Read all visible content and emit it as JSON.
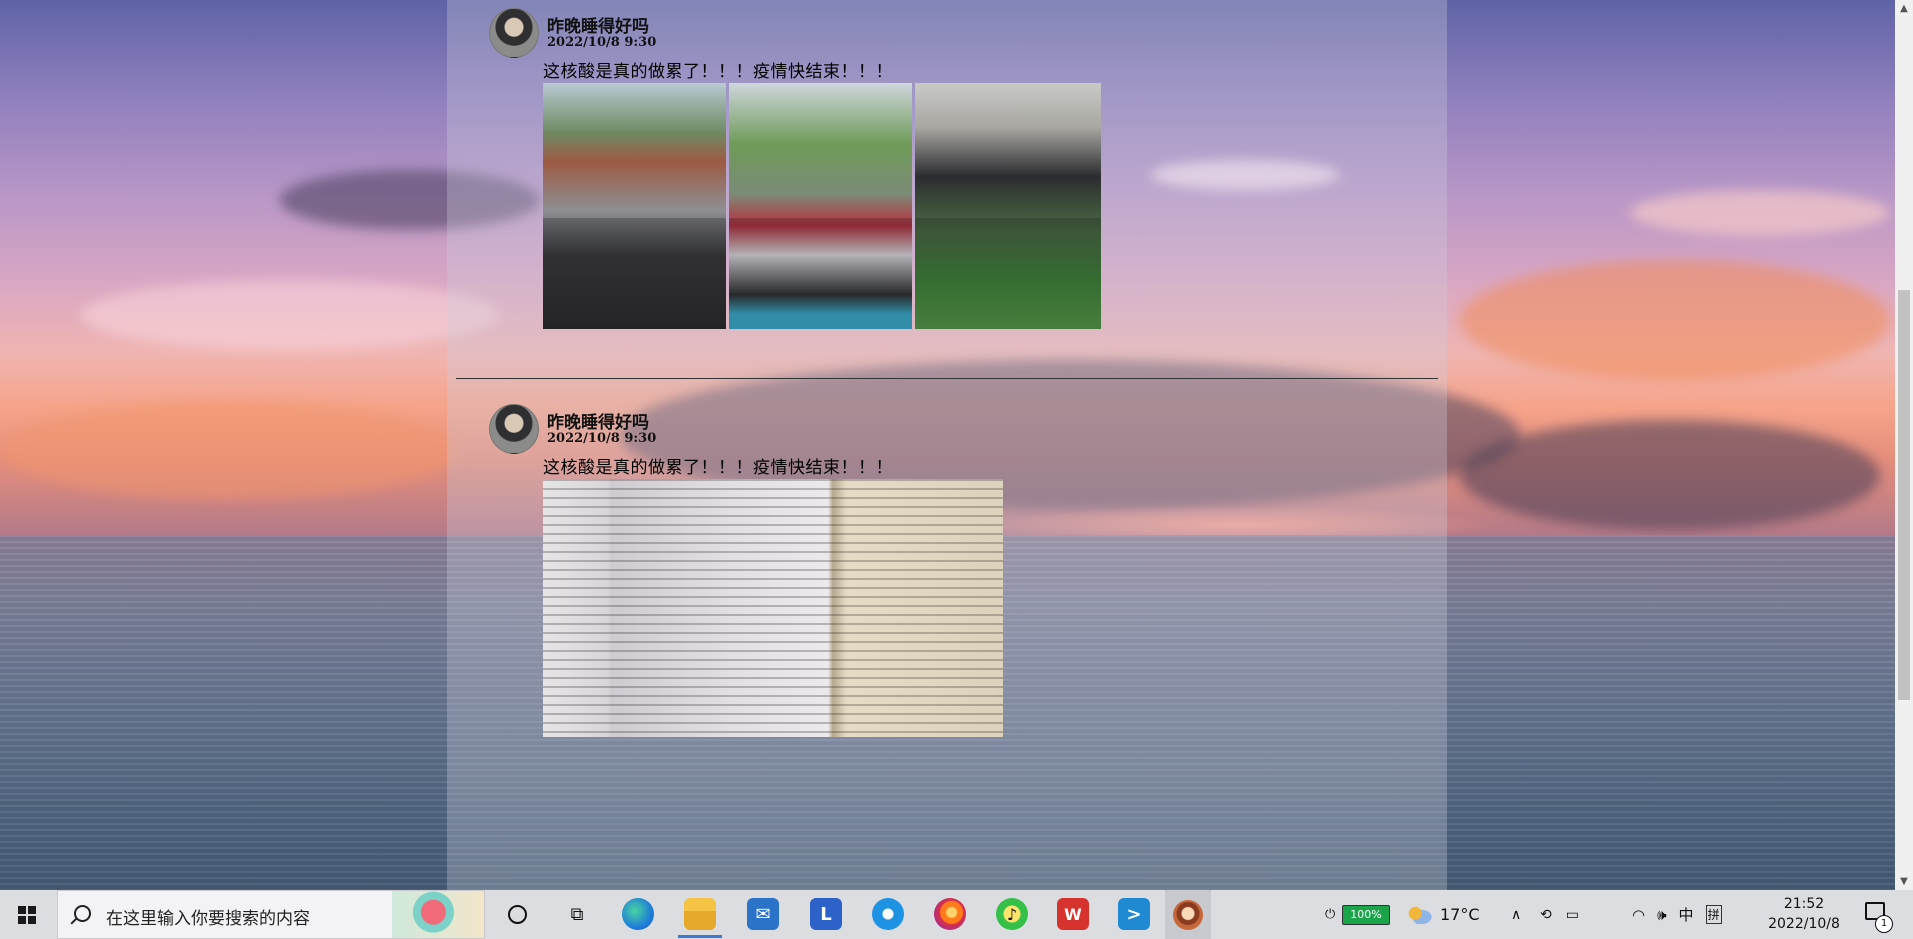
{
  "posts": [
    {
      "username": "昨晚睡得好吗",
      "time": "2022/10/8 9:30",
      "text": "这核酸是真的做累了！！！疫情快结束！！！",
      "photos": [
        "queue-photo",
        "queue-photo",
        "queue-photo"
      ]
    },
    {
      "username": "昨晚睡得好吗",
      "time": "2022/10/8 9:30",
      "text": "这核酸是真的做累了！！！疫情快结束！！！",
      "photos": [
        "notebook-photo"
      ]
    }
  ],
  "taskbar": {
    "search_placeholder": "在这里输入你要搜索的内容",
    "apps": [
      "edge-icon",
      "file-explorer-icon",
      "mail-icon",
      "lenovo-icon",
      "ie-icon",
      "firefox-icon",
      "music-icon",
      "wps-icon",
      "vscode-icon",
      "game-icon"
    ],
    "battery_level": "100%",
    "temperature": "17°C",
    "input_lang": "中",
    "input_mode": "拼",
    "clock_time": "21:52",
    "clock_date": "2022/10/8",
    "notification_count": "1"
  }
}
